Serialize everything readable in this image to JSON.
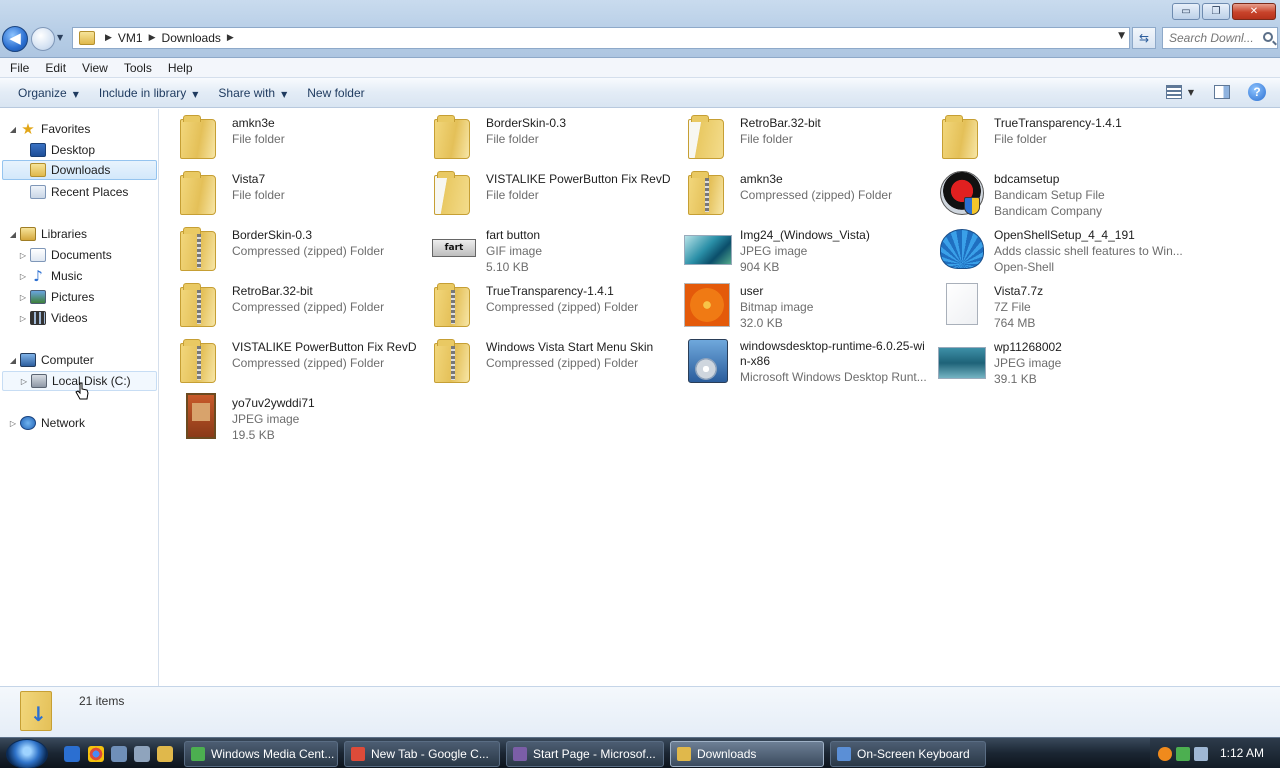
{
  "window": {
    "controls": {
      "minimize": "▭",
      "maximize": "❐",
      "close": "✕"
    }
  },
  "address": {
    "crumbs": [
      "VM1",
      "Downloads"
    ],
    "separator": "▶",
    "search_placeholder": "Search Downl..."
  },
  "menu": [
    "File",
    "Edit",
    "View",
    "Tools",
    "Help"
  ],
  "toolbar": {
    "organize": "Organize",
    "include_in_library": "Include in library",
    "share_with": "Share with",
    "new_folder": "New folder",
    "help": "?"
  },
  "nav": {
    "favorites": "Favorites",
    "desktop": "Desktop",
    "downloads": "Downloads",
    "recent_places": "Recent Places",
    "libraries": "Libraries",
    "documents": "Documents",
    "music": "Music",
    "pictures": "Pictures",
    "videos": "Videos",
    "computer": "Computer",
    "local_disk": "Local Disk (C:)",
    "network": "Network"
  },
  "files": [
    {
      "name": "amkn3e",
      "sub1": "File folder",
      "sub2": "",
      "icon": "folder"
    },
    {
      "name": "BorderSkin-0.3",
      "sub1": "File folder",
      "sub2": "",
      "icon": "folder"
    },
    {
      "name": "RetroBar.32-bit",
      "sub1": "File folder",
      "sub2": "",
      "icon": "folder-open"
    },
    {
      "name": "TrueTransparency-1.4.1",
      "sub1": "File folder",
      "sub2": "",
      "icon": "folder"
    },
    {
      "name": "Vista7",
      "sub1": "File folder",
      "sub2": "",
      "icon": "folder"
    },
    {
      "name": "VISTALIKE PowerButton Fix RevD",
      "sub1": "File folder",
      "sub2": "",
      "icon": "folder-open"
    },
    {
      "name": "amkn3e",
      "sub1": "Compressed (zipped) Folder",
      "sub2": "",
      "icon": "zip"
    },
    {
      "name": "bdcamsetup",
      "sub1": "Bandicam Setup File",
      "sub2": "Bandicam Company",
      "icon": "bandicam"
    },
    {
      "name": "BorderSkin-0.3",
      "sub1": "Compressed (zipped) Folder",
      "sub2": "",
      "icon": "zip"
    },
    {
      "name": "fart button",
      "sub1": "GIF image",
      "sub2": "5.10 KB",
      "icon": "gif"
    },
    {
      "name": "Img24_(Windows_Vista)",
      "sub1": "JPEG image",
      "sub2": "904 KB",
      "icon": "vista"
    },
    {
      "name": "OpenShellSetup_4_4_191",
      "sub1": "Adds classic shell features to Win...",
      "sub2": "Open-Shell",
      "icon": "shell"
    },
    {
      "name": "RetroBar.32-bit",
      "sub1": "Compressed (zipped) Folder",
      "sub2": "",
      "icon": "zip"
    },
    {
      "name": "TrueTransparency-1.4.1",
      "sub1": "Compressed (zipped) Folder",
      "sub2": "",
      "icon": "zip"
    },
    {
      "name": "user",
      "sub1": "Bitmap image",
      "sub2": "32.0 KB",
      "icon": "flower"
    },
    {
      "name": "Vista7.7z",
      "sub1": "7Z File",
      "sub2": "764 MB",
      "icon": "file"
    },
    {
      "name": "VISTALIKE PowerButton Fix RevD",
      "sub1": "Compressed (zipped) Folder",
      "sub2": "",
      "icon": "zip"
    },
    {
      "name": "Windows Vista Start Menu Skin",
      "sub1": "Compressed (zipped) Folder",
      "sub2": "",
      "icon": "zip"
    },
    {
      "name": "windowsdesktop-runtime-6.0.25-win-x86",
      "sub1": "Microsoft Windows Desktop Runt...",
      "sub2": "",
      "icon": "installer"
    },
    {
      "name": "wp11268002",
      "sub1": "JPEG image",
      "sub2": "39.1 KB",
      "icon": "wallpaper"
    },
    {
      "name": "yo7uv2ywddi71",
      "sub1": "JPEG image",
      "sub2": "19.5 KB",
      "icon": "card"
    }
  ],
  "details": {
    "count": "21 items"
  },
  "taskbar": {
    "buttons": [
      {
        "label": "Windows Media Cent...",
        "color": "#4caf50"
      },
      {
        "label": "New Tab - Google C...",
        "color": "#dd4b39"
      },
      {
        "label": "Start Page - Microsof...",
        "color": "#7b5ea7"
      },
      {
        "label": "Downloads",
        "color": "#e0b84b"
      },
      {
        "label": "On-Screen Keyboard",
        "color": "#5b8fd6"
      }
    ],
    "clock": "1:12 AM"
  }
}
